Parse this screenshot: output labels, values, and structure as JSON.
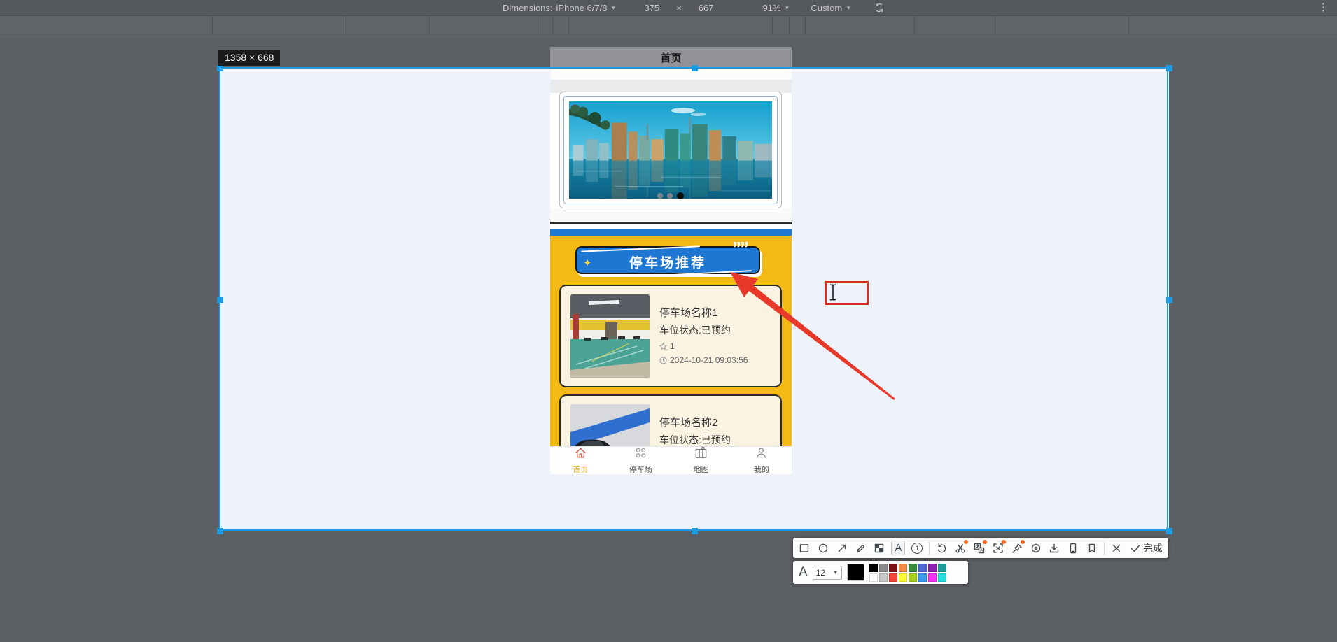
{
  "devtools": {
    "dimensions_label": "Dimensions:",
    "device": "iPhone 6/7/8",
    "viewport_width": "375",
    "multiply_sign": "×",
    "viewport_height": "667",
    "zoom_level": "91%",
    "throttling": "Custom",
    "rotate_icon": "rotate-device-icon",
    "menu_icon": "more-vertical-icon"
  },
  "selection": {
    "size_label": "1358 × 668",
    "accent_color": "#1d9ce2"
  },
  "app": {
    "title": "首页",
    "carousel": {
      "dot_count": 3,
      "active_index": 2
    },
    "banner": {
      "label": "停车场推荐",
      "star": "✦",
      "quote": "””"
    },
    "cards": [
      {
        "name": "停车场名称1",
        "status": "车位状态:已预约",
        "rating": "1",
        "time": "2024-10-21 09:03:56"
      },
      {
        "name": "停车场名称2",
        "status": "车位状态:已预约"
      }
    ],
    "tabs": [
      {
        "label": "首页",
        "icon": "home-icon",
        "active": true
      },
      {
        "label": "停车场",
        "icon": "parking-grid-icon",
        "active": false
      },
      {
        "label": "地图",
        "icon": "map-icon",
        "active": false
      },
      {
        "label": "我的",
        "icon": "user-icon",
        "active": false
      }
    ]
  },
  "shot_toolbar": {
    "tools": [
      {
        "name": "rectangle-tool"
      },
      {
        "name": "ellipse-tool"
      },
      {
        "name": "arrow-tool"
      },
      {
        "name": "pencil-tool"
      },
      {
        "name": "mosaic-tool"
      },
      {
        "name": "text-tool",
        "selected": true
      },
      {
        "name": "number-tool"
      },
      {
        "name": "divider"
      },
      {
        "name": "undo-tool"
      },
      {
        "name": "cut-tool",
        "badge": true
      },
      {
        "name": "translate-tool",
        "badge": true
      },
      {
        "name": "ocr-tool",
        "badge": true
      },
      {
        "name": "pin-tool",
        "badge": true
      },
      {
        "name": "record-tool"
      },
      {
        "name": "download-tool"
      },
      {
        "name": "device-tool"
      },
      {
        "name": "bookmark-tool"
      },
      {
        "name": "divider"
      },
      {
        "name": "close-tool"
      },
      {
        "name": "done-tool",
        "label": "完成"
      }
    ]
  },
  "palette": {
    "font_letter": "A",
    "font_size": "12",
    "current_color": "#000000",
    "row1": [
      "#000000",
      "#8c8c8c",
      "#7c1114",
      "#f28a43",
      "#398a39",
      "#4f68d2",
      "#8a1fb0",
      "#1d9a9a"
    ],
    "row2": [
      "#ffffff",
      "#c9c9c9",
      "#f5473d",
      "#ffff33",
      "#a9d123",
      "#3d9bf0",
      "#fb2ffb",
      "#26e0e0"
    ]
  }
}
